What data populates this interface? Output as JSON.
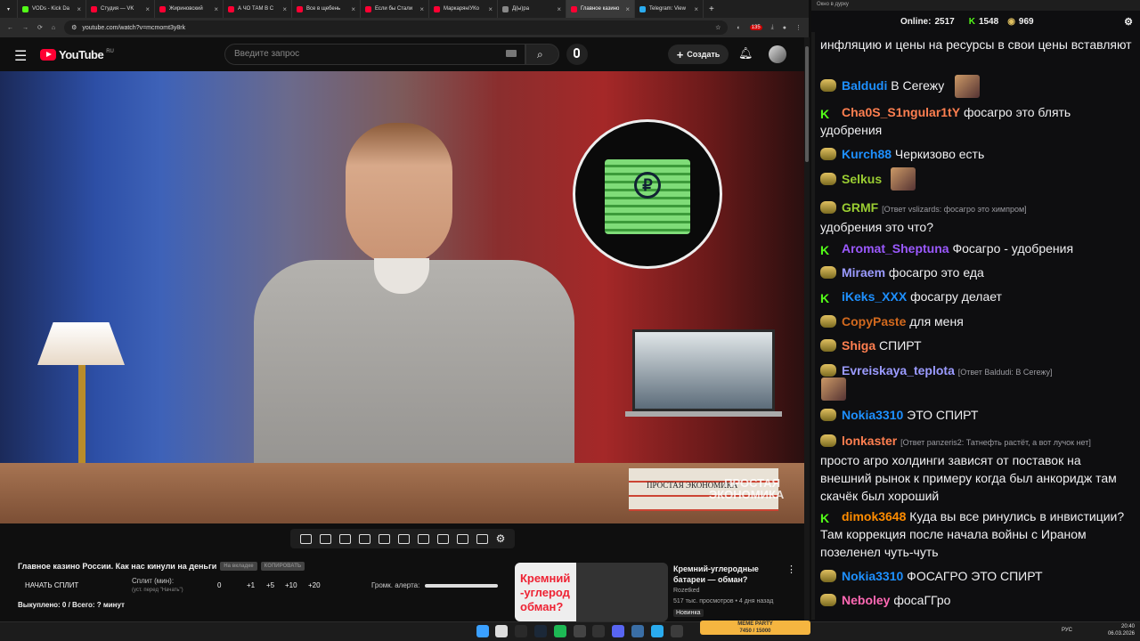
{
  "browser": {
    "tabs": [
      {
        "label": "VODs - Kick Da",
        "color": "#53fc18"
      },
      {
        "label": "Студия — VK",
        "color": "#ff0033"
      },
      {
        "label": "Жириновский",
        "color": "#ff0033"
      },
      {
        "label": "А ЧО ТАМ В С",
        "color": "#ff0033"
      },
      {
        "label": "Все в щебень",
        "color": "#ff0033"
      },
      {
        "label": "Если бы Стали",
        "color": "#ff0033"
      },
      {
        "label": "Маркарян/УКо",
        "color": "#ff0033"
      },
      {
        "label": "Д(ы)ра",
        "color": "#888888"
      },
      {
        "label": "Главное казино",
        "color": "#ff0033"
      },
      {
        "label": "Telegram: View",
        "color": "#2aabee"
      }
    ],
    "url": "youtube.com/watch?v=mcmomt3y8rk",
    "ext_badge_1": "135"
  },
  "youtube": {
    "logo": "YouTube",
    "region": "RU",
    "search_placeholder": "Введите запрос",
    "create_label": "Создать",
    "watermark": "ПРОСТАЯ ЭКОНОМИКА",
    "book_text": "ПРОСТАЯ ЭКОНОМИКА"
  },
  "split_panel": {
    "title": "Главное казино России. Как нас кинули на деньги",
    "btn1": "На вкладке",
    "btn2": "КОПИРОВАТЬ",
    "start_split": "НАЧАТЬ СПЛИТ",
    "split_label": "Сплит (мин):",
    "split_hint": "(уст. перед \"Начать\")",
    "split_value": "0",
    "increments": [
      "+1",
      "+5",
      "+10",
      "+20"
    ],
    "volume_label": "Громк. алерта:",
    "bought": "Выкуплено: 0 / Всего: ? минут"
  },
  "recommendation": {
    "thumb_text": "Кремний -углерод обман?",
    "title": "Кремний-углеродные батареи — обман?",
    "channel": "Rozetked",
    "meta": "517 тыс. просмотров • 4 дня назад",
    "tag": "Новинка"
  },
  "chat": {
    "window_title": "Окно в дурку",
    "online_label": "Online:",
    "online": "2517",
    "kick_count": "1548",
    "other_count": "969",
    "messages": [
      {
        "user": "",
        "text": "инфляцию и цены на ресурсы в свои цены вставляют",
        "color": "#efeff1"
      },
      {
        "user": "Baldudi",
        "text": "В Сегежу",
        "color": "#1e90ff"
      },
      {
        "user": "Cha0S_S1ngular1tY",
        "text": "фосагро это блять удобрения",
        "color": "#ff7f50"
      },
      {
        "user": "Kurch88",
        "text": "Черкизово есть",
        "color": "#1e90ff"
      },
      {
        "user": "Selkus",
        "text": "",
        "color": "#9acd32"
      },
      {
        "user": "GRMF",
        "reply": "[Ответ vslizards: фосагро это химпром]",
        "text": "удобрения это что?",
        "color": "#9acd32"
      },
      {
        "user": "Aromat_Sheptuna",
        "text": "Фосагро - удобрения",
        "color": "#9b59ff"
      },
      {
        "user": "Miraem",
        "text": "фосагро это еда",
        "color": "#9b9bff"
      },
      {
        "user": "iKeks_XXX",
        "text": "фосагру делает",
        "color": "#1e90ff"
      },
      {
        "user": "CopyPaste",
        "text": "для меня",
        "color": "#d2691e"
      },
      {
        "user": "Shiga",
        "text": "СПИРТ",
        "color": "#ff7f50"
      },
      {
        "user": "Evreiskaya_teplota",
        "reply": "[Ответ Baldudi: В Сегежу]",
        "text": "",
        "color": "#9b9bff"
      },
      {
        "user": "Nokia3310",
        "text": "ЭТО СПИРТ",
        "color": "#1e90ff"
      },
      {
        "user": "lonkaster",
        "reply": "[Ответ panzeris2: Татнефть растёт, а вот лучок нет]",
        "text": "просто агро холдинги зависят от поставок на внешний рынок к примеру когда был анкоридж там скачёк был хороший",
        "color": "#ff7f50"
      },
      {
        "user": "dimok3648",
        "text": "Куда вы все ринулись в инвистиции? Там коррекция после начала войны с Ираном позеленел чуть-чуть",
        "color": "#ff8c00"
      },
      {
        "user": "Nokia3310",
        "text": "ФОСАГРО ЭТО СПИРТ",
        "color": "#1e90ff"
      },
      {
        "user": "Neboley",
        "text": "фосаГГро",
        "color": "#ff69b4"
      }
    ]
  },
  "taskbar": {
    "meme_label": "MEME PARTY",
    "meme_value": "7450 / 15000",
    "lang": "РУС",
    "time": "20:40",
    "date": "06.03.2026"
  }
}
